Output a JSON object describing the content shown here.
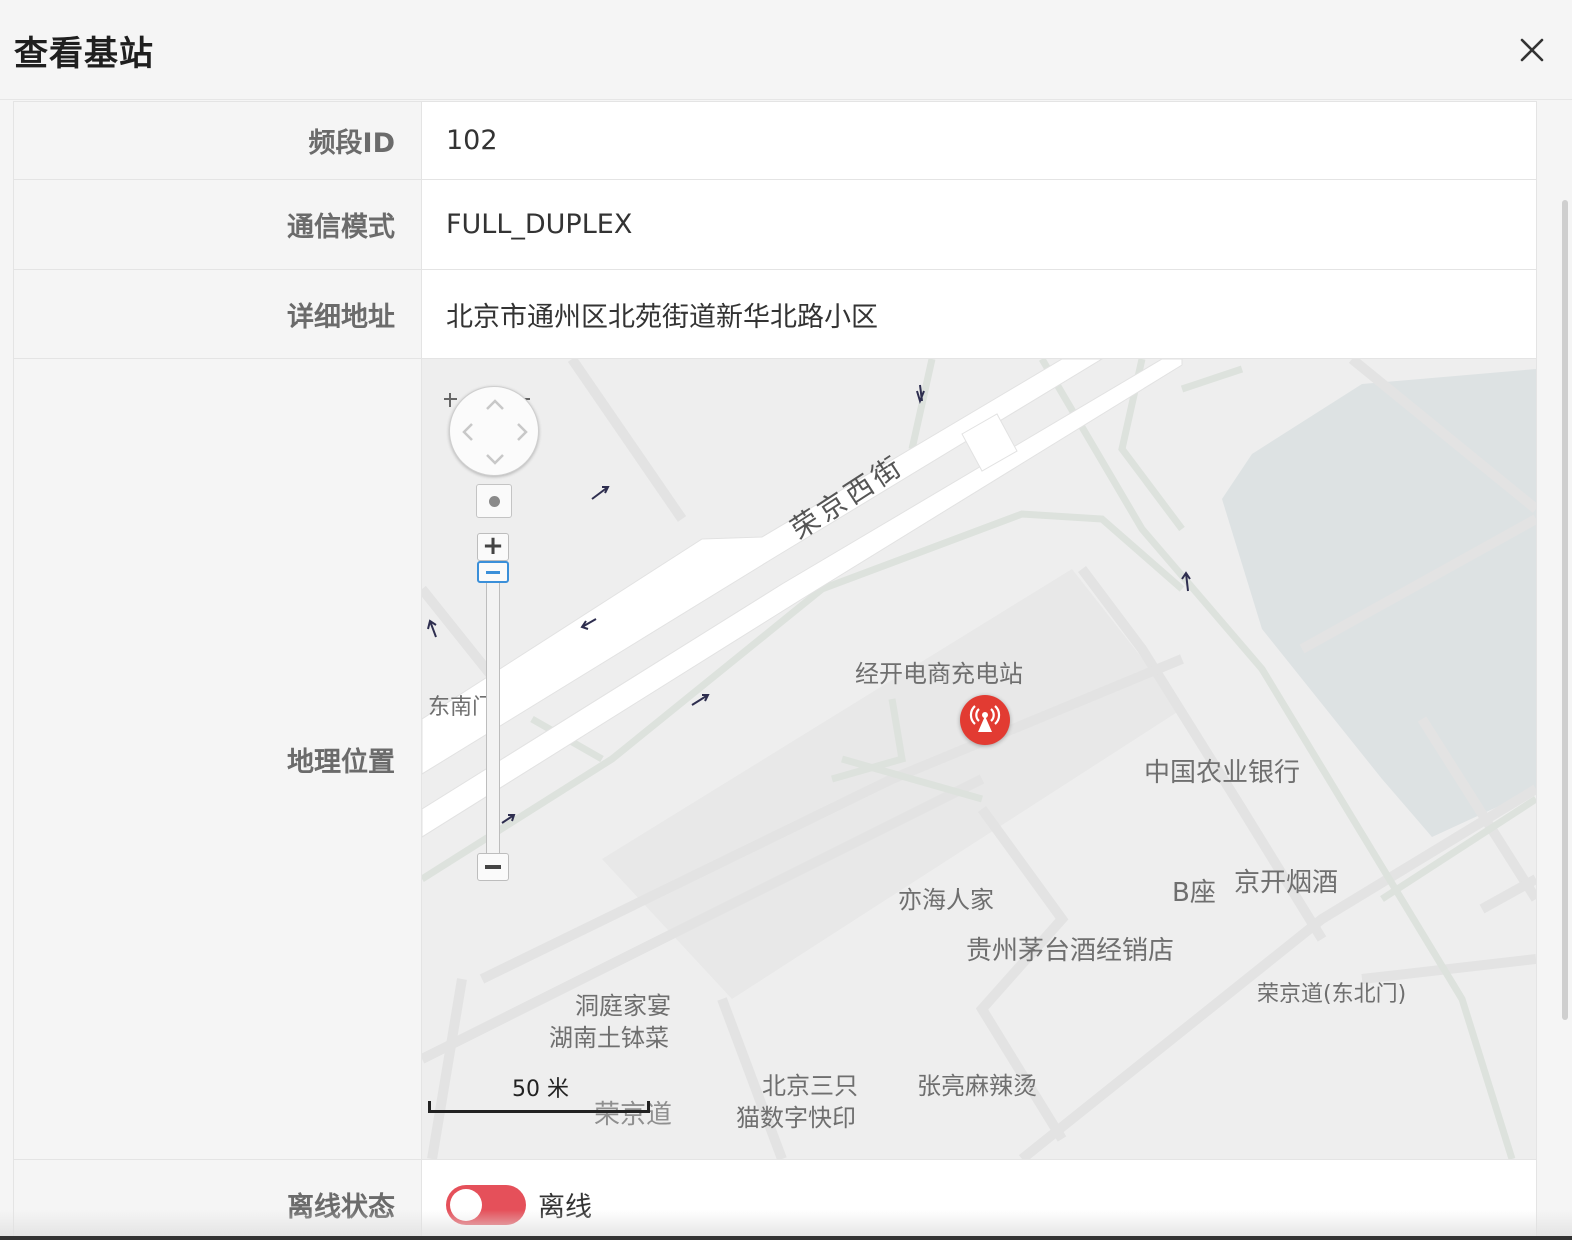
{
  "dialog": {
    "title": "查看基站",
    "close_icon": "close-icon"
  },
  "rows": [
    {
      "label": "频段ID",
      "value": "102"
    },
    {
      "label": "通信模式",
      "value": "FULL_DUPLEX"
    },
    {
      "label": "详细地址",
      "value": "北京市通州区北苑街道新华北路小区"
    },
    {
      "label": "地理位置"
    },
    {
      "label": "离线状态",
      "value": "离线"
    }
  ],
  "map": {
    "road_label": "荣京西街",
    "pois": {
      "station": "经开电商充电站",
      "east_gate": "东南门",
      "abc_bank": "中国农业银行",
      "yihai": "亦海人家",
      "b_block": "B座",
      "jingkai_liquor": "京开烟酒",
      "maotai": "贵州茅台酒经销店",
      "dongting": "洞庭家宴",
      "hunan": "湖南土钵菜",
      "rongjing_north": "荣京道(东北门)",
      "sanzhimao_1": "北京三只",
      "sanzhimao_2": "猫数字快印",
      "malatang": "张亮麻辣烫",
      "rongjing_road": "荣京道"
    },
    "scale": "50 米",
    "marker_icon": "base-station-icon",
    "marker_color": "#e23b32"
  },
  "status": {
    "offline": true,
    "toggle_color": "#e5505a"
  }
}
